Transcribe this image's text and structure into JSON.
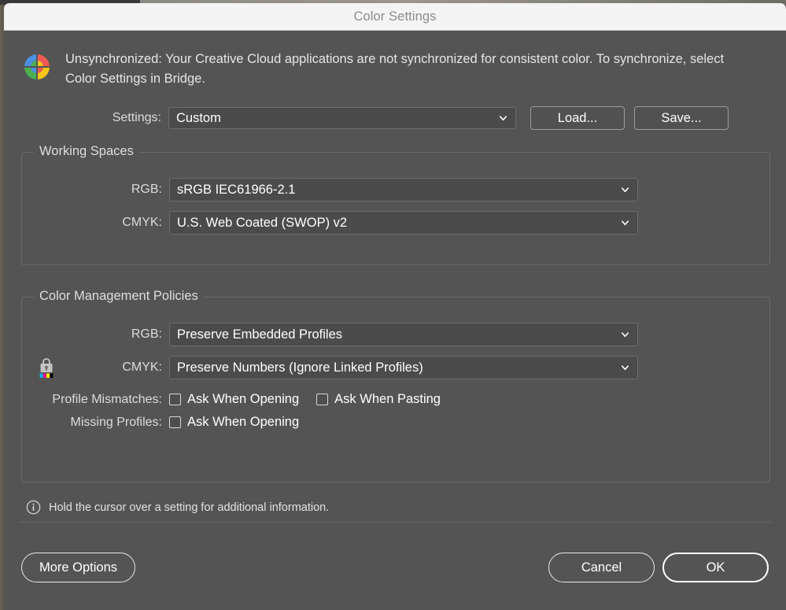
{
  "window": {
    "title": "Color Settings"
  },
  "sync_banner": {
    "icon": "creative-cloud-color-wheel-icon",
    "message": "Unsynchronized: Your Creative Cloud applications are not synchronized for consistent color. To synchronize, select Color Settings in Bridge."
  },
  "settings": {
    "label": "Settings:",
    "value": "Custom",
    "load_label": "Load...",
    "save_label": "Save..."
  },
  "working_spaces": {
    "legend": "Working Spaces",
    "rgb_label": "RGB:",
    "rgb_value": "sRGB IEC61966-2.1",
    "cmyk_label": "CMYK:",
    "cmyk_value": "U.S. Web Coated (SWOP) v2"
  },
  "policies": {
    "legend": "Color Management Policies",
    "rgb_label": "RGB:",
    "rgb_value": "Preserve Embedded Profiles",
    "cmyk_label": "CMYK:",
    "cmyk_value": "Preserve Numbers (Ignore Linked Profiles)",
    "lock_icon": "lock-cmyk-icon",
    "profile_mismatches_label": "Profile Mismatches:",
    "mismatch_open_label": "Ask When Opening",
    "mismatch_open_checked": false,
    "mismatch_paste_label": "Ask When Pasting",
    "mismatch_paste_checked": false,
    "missing_profiles_label": "Missing Profiles:",
    "missing_open_label": "Ask When Opening",
    "missing_open_checked": false
  },
  "hint": {
    "icon": "info-circle-icon",
    "text": "Hold the cursor over a setting for additional information."
  },
  "footer": {
    "more_options_label": "More Options",
    "cancel_label": "Cancel",
    "ok_label": "OK"
  },
  "colors": {
    "window_bg": "#545454",
    "titlebar_bg": "#f4f4f4",
    "field_bg": "#4b4b4b",
    "border": "#6a6a6a",
    "text": "#ffffff",
    "cc_red": "#ee5a52",
    "cc_blue": "#4a90e2",
    "cc_yellow": "#f5c518",
    "cc_green": "#4caf50",
    "cmyk_cyan": "#00aeef",
    "cmyk_magenta": "#ec008c",
    "cmyk_yellow": "#fff200",
    "cmyk_black": "#000000"
  }
}
